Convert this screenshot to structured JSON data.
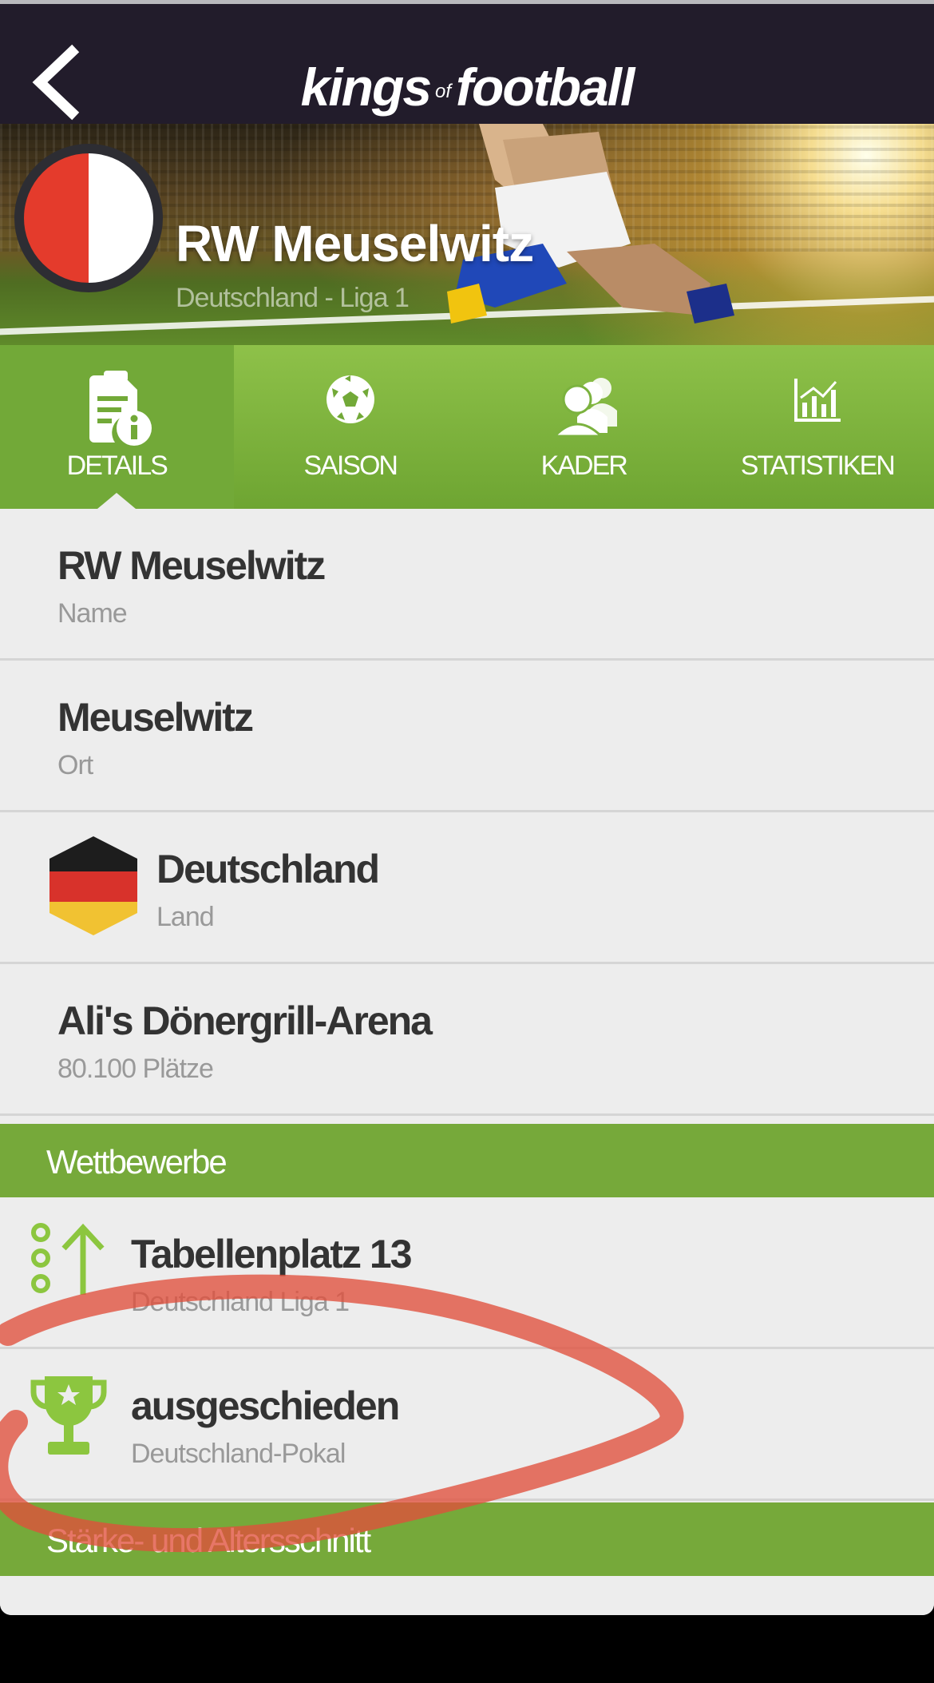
{
  "header": {
    "logo_left": "kings",
    "logo_of": "of",
    "logo_right": "football"
  },
  "club": {
    "name": "RW Meuselwitz",
    "league": "Deutschland - Liga 1",
    "badge_colors": [
      "#e43b2c",
      "#ffffff"
    ]
  },
  "tabs": [
    {
      "label": "DETAILS",
      "icon": "document-info-icon",
      "active": true
    },
    {
      "label": "SAISON",
      "icon": "soccer-ball-icon",
      "active": false
    },
    {
      "label": "KADER",
      "icon": "team-people-icon",
      "active": false
    },
    {
      "label": "STATISTIKEN",
      "icon": "bar-chart-icon",
      "active": false
    }
  ],
  "details": [
    {
      "value": "RW Meuselwitz",
      "label": "Name"
    },
    {
      "value": "Meuselwitz",
      "label": "Ort"
    },
    {
      "value": "Deutschland",
      "label": "Land",
      "icon": "germany-flag-icon"
    },
    {
      "value": "Ali's Dönergrill-Arena",
      "label": "80.100 Plätze"
    }
  ],
  "competitions": {
    "header": "Wettbewerbe",
    "items": [
      {
        "value": "Tabellenplatz 13",
        "label": "Deutschland Liga 1",
        "icon": "rank-up-icon"
      },
      {
        "value": "ausgeschieden",
        "label": "Deutschland-Pokal",
        "icon": "trophy-icon"
      }
    ]
  },
  "strength": {
    "header": "Stärke- und Altersschnitt"
  },
  "colors": {
    "accent_green": "#76a93a",
    "topbar": "#221c2b",
    "annotation_red": "#e0503c"
  }
}
